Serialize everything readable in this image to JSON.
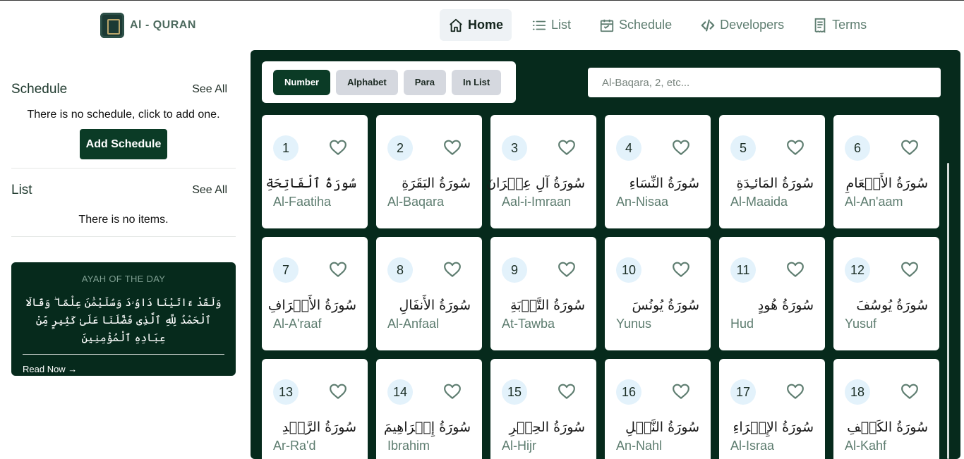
{
  "app": {
    "logo_text": "Al - QURAN"
  },
  "nav": [
    {
      "label": "Home",
      "icon": "home-icon",
      "active": true
    },
    {
      "label": "List",
      "icon": "list-icon",
      "active": false
    },
    {
      "label": "Schedule",
      "icon": "calendar-icon",
      "active": false
    },
    {
      "label": "Developers",
      "icon": "code-icon",
      "active": false
    },
    {
      "label": "Terms",
      "icon": "document-icon",
      "active": false
    }
  ],
  "sidebar": {
    "schedule": {
      "title": "Schedule",
      "see_all": "See All",
      "empty": "There is no schedule, click to add one.",
      "add_button": "Add Schedule"
    },
    "list": {
      "title": "List",
      "see_all": "See All",
      "empty": "There is no items."
    },
    "ayah": {
      "title": "AYAH OF THE DAY",
      "text": "وَلَقَدْ ءَاتَيْنَا دَاوُۥدَ وَسُلَيْمَٰنَ عِلْمًا ۖ وَقَالَا ٱلْحَمْدُ لِلَّهِ ٱلَّذِى فَضَّلَنَا عَلَىٰ كَثِيرٍ مِّنْ عِبَادِهِ ٱلْمُؤْمِنِينَ",
      "read_now": "Read Now →"
    }
  },
  "sort": {
    "options": [
      "Number",
      "Alphabet",
      "Para",
      "In List"
    ],
    "active": "Number"
  },
  "search": {
    "placeholder": "Al-Baqara, 2, etc..."
  },
  "surahs": [
    {
      "number": "1",
      "arabic": "سُورَةُ ٱلْفَاتِحَةِ",
      "name": "Al-Faatiha"
    },
    {
      "number": "2",
      "arabic": "سُورَةُ البَقَرَةِ",
      "name": "Al-Baqara"
    },
    {
      "number": "3",
      "arabic": "سُورَةُ آلِ عِمۡرَانَ",
      "name": "Aal-i-Imraan"
    },
    {
      "number": "4",
      "arabic": "سُورَةُ النِّسَاءِ",
      "name": "An-Nisaa"
    },
    {
      "number": "5",
      "arabic": "سُورَةُ المَائـِدَةِ",
      "name": "Al-Maaida"
    },
    {
      "number": "6",
      "arabic": "سُورَةُ الأَنۡعَامِ",
      "name": "Al-An'aam"
    },
    {
      "number": "7",
      "arabic": "سُورَةُ الأَعۡرَافِ",
      "name": "Al-A'raaf"
    },
    {
      "number": "8",
      "arabic": "سُورَةُ الأَنفَالِ",
      "name": "Al-Anfaal"
    },
    {
      "number": "9",
      "arabic": "سُورَةُ التَّوۡبَةِ",
      "name": "At-Tawba"
    },
    {
      "number": "10",
      "arabic": "سُورَةُ يُونُسَ",
      "name": "Yunus"
    },
    {
      "number": "11",
      "arabic": "سُورَةُ هُودٍ",
      "name": "Hud"
    },
    {
      "number": "12",
      "arabic": "سُورَةُ يُوسُفَ",
      "name": "Yusuf"
    },
    {
      "number": "13",
      "arabic": "سُورَةُ الرَّعۡدِ",
      "name": "Ar-Ra'd"
    },
    {
      "number": "14",
      "arabic": "سُورَةُ إِبۡرَاهِيمَ",
      "name": "Ibrahim"
    },
    {
      "number": "15",
      "arabic": "سُورَةُ الحِجۡرِ",
      "name": "Al-Hijr"
    },
    {
      "number": "16",
      "arabic": "سُورَةُ النَّحۡلِ",
      "name": "An-Nahl"
    },
    {
      "number": "17",
      "arabic": "سُورَةُ الإِسۡرَاءِ",
      "name": "Al-Israa"
    },
    {
      "number": "18",
      "arabic": "سُورَةُ الكَهۡفِ",
      "name": "Al-Kahf"
    }
  ],
  "colors": {
    "primary": "#0b3b26",
    "panel": "#062a1c",
    "accent_text": "#5e7d70",
    "badge": "#e3f2fb"
  }
}
